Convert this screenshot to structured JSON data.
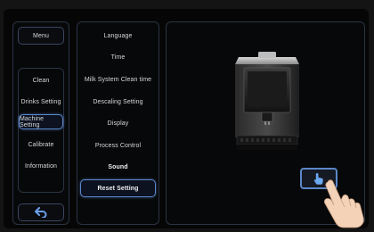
{
  "left_panel": {
    "menu_label": "Menu",
    "items": [
      {
        "label": "Clean"
      },
      {
        "label": "Drinks Setting"
      },
      {
        "label": "Machine Setting"
      },
      {
        "label": "Calibrate"
      },
      {
        "label": "Information"
      }
    ],
    "selected": "Machine Setting",
    "back_icon": "back-arrow-icon"
  },
  "middle_panel": {
    "items": [
      {
        "label": "Language"
      },
      {
        "label": "Time"
      },
      {
        "label": "Milk System Clean time"
      },
      {
        "label": "Descaling Setting"
      },
      {
        "label": "Display"
      },
      {
        "label": "Process Control"
      },
      {
        "label": "Sound"
      },
      {
        "label": "Reset Setting"
      }
    ],
    "selected": "Reset Setting"
  },
  "preview": {
    "machine_icon": "coffee-machine-icon",
    "touch_icon": "hand-pointer-icon",
    "accent": "#5b87c9"
  }
}
